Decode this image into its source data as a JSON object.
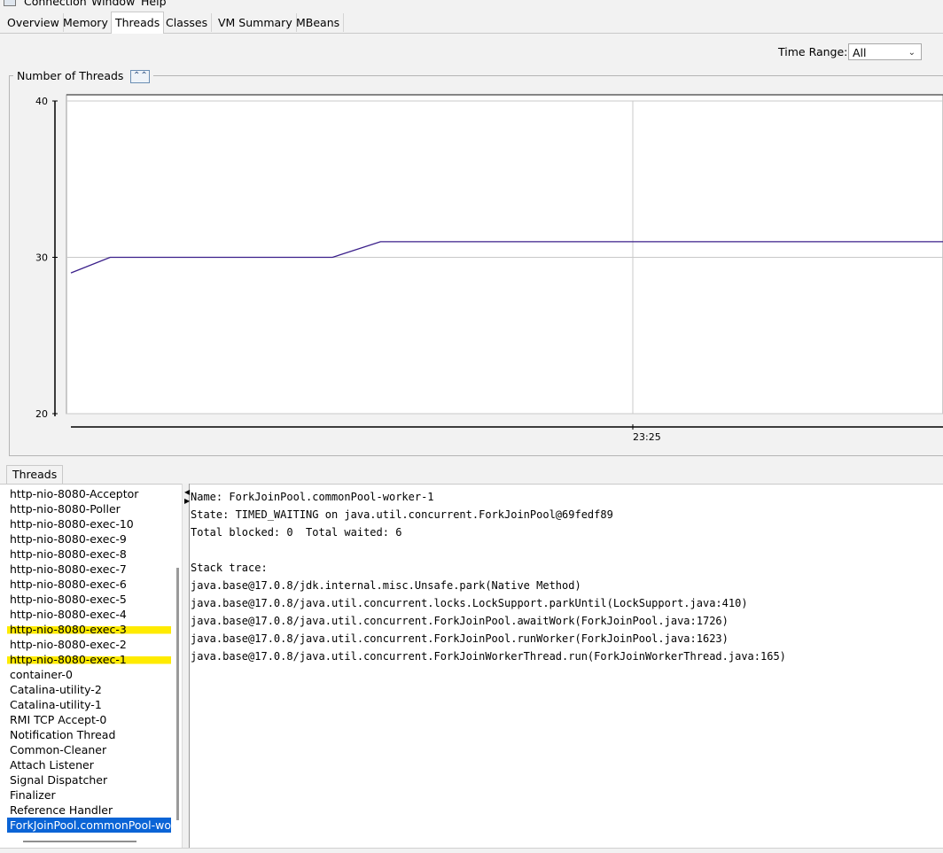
{
  "menu": {
    "items": [
      "Connection",
      "Window",
      "Help"
    ]
  },
  "tabs": [
    "Overview",
    "Memory",
    "Threads",
    "Classes",
    "VM Summary",
    "MBeans"
  ],
  "selected_tab": "Threads",
  "time_range": {
    "label": "Time Range:",
    "value": "All"
  },
  "chart_panel": {
    "title": "Number of Threads",
    "collapse_icon": "double-chevron-up-icon"
  },
  "chart_data": {
    "type": "line",
    "title": "Number of Threads",
    "y_ticks": [
      "40",
      "30",
      "20"
    ],
    "ylim": [
      20,
      40
    ],
    "x_ticks": [
      "23:25"
    ],
    "grid": true,
    "series": [
      {
        "color": "#3a1f8a",
        "points": [
          {
            "t": 0,
            "v": 29
          },
          {
            "t": 0.045,
            "v": 30
          },
          {
            "t": 0.3,
            "v": 30
          },
          {
            "t": 0.355,
            "v": 31
          },
          {
            "t": 1.0,
            "v": 31
          }
        ]
      }
    ]
  },
  "threads_section": {
    "tab_label": "Threads",
    "list": [
      "http-nio-8080-Acceptor",
      "http-nio-8080-Poller",
      "http-nio-8080-exec-10",
      "http-nio-8080-exec-9",
      "http-nio-8080-exec-8",
      "http-nio-8080-exec-7",
      "http-nio-8080-exec-6",
      "http-nio-8080-exec-5",
      "http-nio-8080-exec-4",
      "http-nio-8080-exec-3",
      "http-nio-8080-exec-2",
      "http-nio-8080-exec-1",
      "container-0",
      "Catalina-utility-2",
      "Catalina-utility-1",
      "RMI TCP Accept-0",
      "Notification Thread",
      "Common-Cleaner",
      "Attach Listener",
      "Signal Dispatcher",
      "Finalizer",
      "Reference Handler",
      "ForkJoinPool.commonPool-wor"
    ],
    "highlighted": [
      9,
      11
    ],
    "selected_index": 22,
    "highlight_color": "#ffeb00"
  },
  "thread_details": {
    "lines": [
      "Name: ForkJoinPool.commonPool-worker-1",
      "State: TIMED_WAITING on java.util.concurrent.ForkJoinPool@69fedf89",
      "Total blocked: 0  Total waited: 6",
      "",
      "Stack trace:",
      "java.base@17.0.8/jdk.internal.misc.Unsafe.park(Native Method)",
      "java.base@17.0.8/java.util.concurrent.locks.LockSupport.parkUntil(LockSupport.java:410)",
      "java.base@17.0.8/java.util.concurrent.ForkJoinPool.awaitWork(ForkJoinPool.java:1726)",
      "java.base@17.0.8/java.util.concurrent.ForkJoinPool.runWorker(ForkJoinPool.java:1623)",
      "java.base@17.0.8/java.util.concurrent.ForkJoinWorkerThread.run(ForkJoinWorkerThread.java:165)"
    ]
  }
}
